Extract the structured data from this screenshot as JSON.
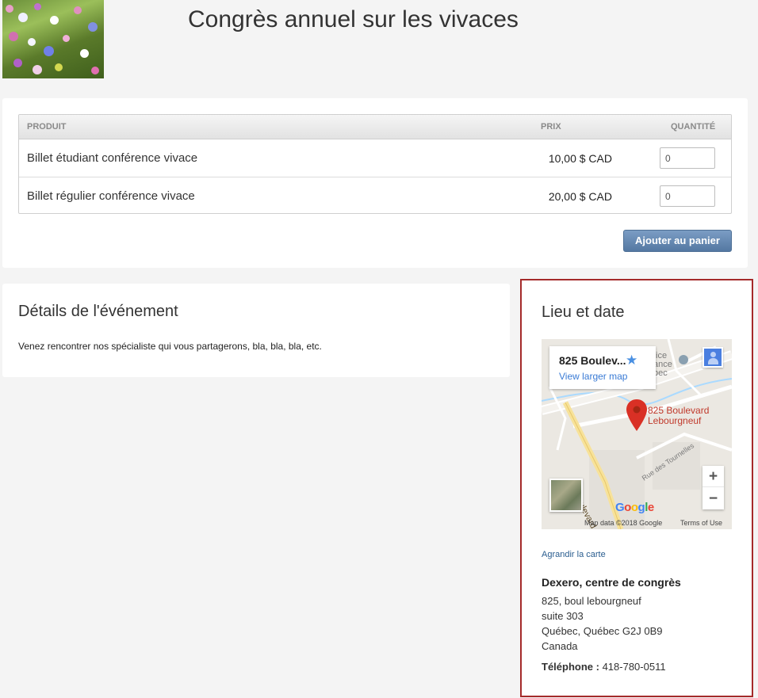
{
  "page": {
    "title": "Congrès annuel sur les vivaces"
  },
  "cart": {
    "columns": {
      "product": "PRODUIT",
      "price": "PRIX",
      "quantity": "QUANTITÉ"
    },
    "rows": [
      {
        "name": "Billet étudiant conférence vivace",
        "price": "10,00 $ CAD",
        "quantity": "0"
      },
      {
        "name": "Billet régulier conférence vivace",
        "price": "20,00 $ CAD",
        "quantity": "0"
      }
    ],
    "add_button": "Ajouter au panier"
  },
  "details": {
    "title": "Détails de l'événement",
    "text": "Venez rencontrer nos spécialiste qui vous partagerons, bla, bla, bla, etc."
  },
  "location": {
    "title": "Lieu et date",
    "map": {
      "card_address": "825 Boulev...",
      "view_larger": "View larger map",
      "pin_label_1": "825 Boulevard",
      "pin_label_2": "Lebourgneuf",
      "poi_label": "fice\nance\nbec",
      "street_label": "Rue des Tournelles",
      "road_label": "Boulevard P",
      "zoom_in": "+",
      "zoom_out": "−",
      "map_data": "Map data ©2018 Google",
      "terms": "Terms of Use"
    },
    "enlarge_link": "Agrandir la carte",
    "venue_name": "Dexero, centre de congrès",
    "address_lines": [
      "825, boul lebourgneuf",
      "suite 303",
      "Québec, Québec G2J 0B9",
      "Canada"
    ],
    "phone_label": "Téléphone :",
    "phone": "418-780-0511"
  },
  "colors": {
    "page_background": "#f4f4f4",
    "button_blue": "#5478a2",
    "highlight_border": "#a42a2a",
    "pin_red": "#d93025",
    "link_blue": "#2a5d8f"
  }
}
